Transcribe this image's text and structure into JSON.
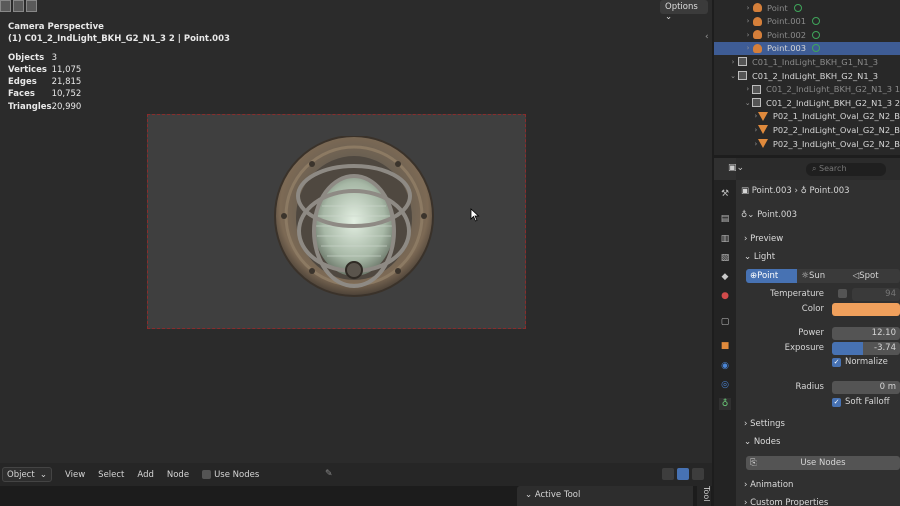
{
  "viewport": {
    "perspective": "Camera Perspective",
    "object_name": "(1) C01_2_IndLight_BKH_G2_N1_3 2 | Point.003",
    "stats": [
      {
        "label": "Objects",
        "value": "3"
      },
      {
        "label": "Vertices",
        "value": "11,075"
      },
      {
        "label": "Edges",
        "value": "21,815"
      },
      {
        "label": "Faces",
        "value": "10,752"
      },
      {
        "label": "Triangles",
        "value": "20,990"
      }
    ],
    "options_label": "Options"
  },
  "bottom_bar": {
    "mode": "Object",
    "menus": [
      "View",
      "Select",
      "Add",
      "Node"
    ],
    "use_nodes": "Use Nodes",
    "active_tool": "Active Tool",
    "tool_tab": "Tool"
  },
  "outliner": {
    "rows": [
      {
        "label": "Point",
        "type": "light",
        "indent": 1,
        "dim": true
      },
      {
        "label": "Point.001",
        "type": "light",
        "indent": 1,
        "dim": true
      },
      {
        "label": "Point.002",
        "type": "light",
        "indent": 1,
        "dim": true
      },
      {
        "label": "Point.003",
        "type": "light",
        "indent": 1,
        "selected": true
      },
      {
        "label": "C01_1_IndLight_BKH_G1_N1_3",
        "type": "coll",
        "indent": 0,
        "dim": true
      },
      {
        "label": "C01_2_IndLight_BKH_G2_N1_3",
        "type": "coll",
        "indent": 0
      },
      {
        "label": "C01_2_IndLight_BKH_G2_N1_3 1",
        "type": "coll",
        "indent": 1,
        "dim": true
      },
      {
        "label": "C01_2_IndLight_BKH_G2_N1_3 2",
        "type": "coll",
        "indent": 1
      },
      {
        "label": "P02_1_IndLight_Oval_G2_N2_B",
        "type": "mesh",
        "indent": 2
      },
      {
        "label": "P02_2_IndLight_Oval_G2_N2_B",
        "type": "mesh",
        "indent": 2
      },
      {
        "label": "P02_3_IndLight_Oval_G2_N2_B",
        "type": "mesh",
        "indent": 2
      }
    ]
  },
  "properties": {
    "search_placeholder": "Search",
    "breadcrumb_object": "Point.003",
    "breadcrumb_data": "Point.003",
    "datablock": "Point.003",
    "sections": {
      "preview": "Preview",
      "light": "Light",
      "settings": "Settings",
      "nodes": "Nodes",
      "animation": "Animation",
      "custom_properties": "Custom Properties"
    },
    "light_types": [
      "Point",
      "Sun",
      "Spot"
    ],
    "temperature_label": "Temperature",
    "temperature_value": "94",
    "color_label": "Color",
    "color_value": "#f0a05c",
    "power_label": "Power",
    "power_value": "12.10",
    "exposure_label": "Exposure",
    "exposure_value": "-3.74",
    "exposure_fill": 0.45,
    "normalize_label": "Normalize",
    "radius_label": "Radius",
    "radius_value": "0 m",
    "soft_falloff_label": "Soft Falloff",
    "use_nodes_button": "Use Nodes"
  }
}
